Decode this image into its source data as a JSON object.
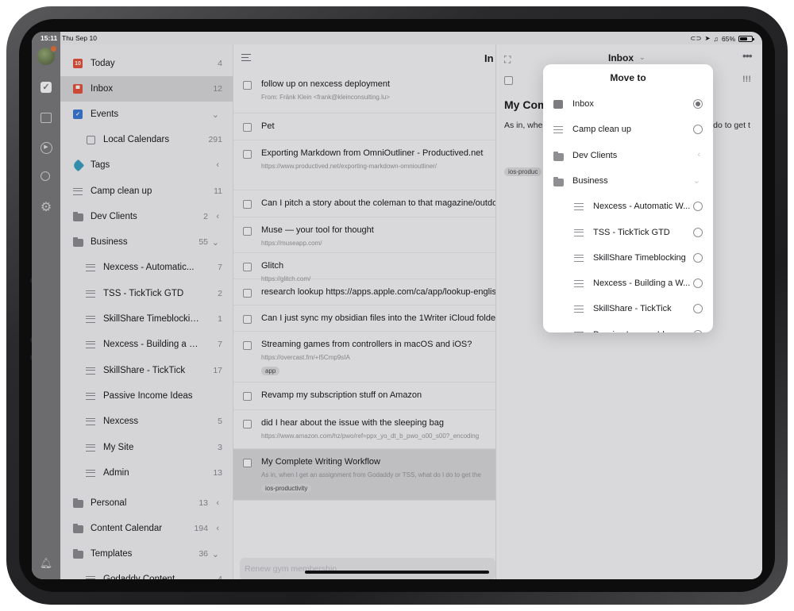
{
  "status_bar": {
    "time": "15:11",
    "date": "Thu Sep 10",
    "battery": "65%"
  },
  "sidebar": {
    "items": [
      {
        "label": "Today",
        "count": "4",
        "icon": "calendar-icon",
        "color": "#e8543f"
      },
      {
        "label": "Inbox",
        "count": "12",
        "icon": "inbox-icon",
        "color": "#e8543f"
      },
      {
        "label": "Events",
        "count": "",
        "icon": "events-icon",
        "color": "#3d7bd9"
      },
      {
        "label": "Local Calendars",
        "count": "291",
        "icon": "calendar-grid-icon"
      },
      {
        "label": "Tags",
        "count": "",
        "icon": "tag-icon",
        "color": "#3aa3c5"
      },
      {
        "label": "Camp clean up",
        "count": "11",
        "icon": "list-icon"
      },
      {
        "label": "Dev Clients",
        "count": "2",
        "icon": "folder-icon"
      },
      {
        "label": "Business",
        "count": "55",
        "icon": "folder-icon"
      },
      {
        "label": "Nexcess - Automatic...",
        "count": "7",
        "icon": "list-icon"
      },
      {
        "label": "TSS - TickTick GTD",
        "count": "2",
        "icon": "list-icon"
      },
      {
        "label": "SkillShare Timeblocking",
        "count": "1",
        "icon": "list-icon"
      },
      {
        "label": "Nexcess - Building a W...",
        "count": "7",
        "icon": "list-icon"
      },
      {
        "label": "SkillShare - TickTick",
        "count": "17",
        "icon": "shared-list-icon"
      },
      {
        "label": "Passive Income Ideas",
        "count": "",
        "icon": "list-icon"
      },
      {
        "label": "Nexcess",
        "count": "5",
        "icon": "list-icon"
      },
      {
        "label": "My Site",
        "count": "3",
        "icon": "list-icon"
      },
      {
        "label": "Admin",
        "count": "13",
        "icon": "list-icon"
      },
      {
        "label": "Personal",
        "count": "13",
        "icon": "folder-icon"
      },
      {
        "label": "Content Calendar",
        "count": "194",
        "icon": "folder-icon"
      },
      {
        "label": "Templates",
        "count": "36",
        "icon": "folder-icon"
      },
      {
        "label": "Godaddy Content",
        "count": "4",
        "icon": "list-icon"
      }
    ]
  },
  "list": {
    "header_title": "In",
    "tasks": [
      {
        "title": "follow up on nexcess deployment",
        "sub": "From: Fränk Klein <frank@kleinconsulting.lu>",
        "tag": ""
      },
      {
        "title": "Pet",
        "sub": "",
        "tag": ""
      },
      {
        "title": "Exporting Markdown from OmniOutliner - Productived.net",
        "sub": "https://www.productived.net/exporting-markdown-omnioutliner/",
        "tag": ""
      },
      {
        "title": "Can I pitch a story about the coleman to that magazine/outdoor",
        "sub": "",
        "tag": ""
      },
      {
        "title": "Muse — your tool for thought",
        "sub": "https://museapp.com/",
        "tag": ""
      },
      {
        "title": "Glitch",
        "sub": "https://glitch.com/",
        "tag": ""
      },
      {
        "title": "research lookup https://apps.apple.com/ca/app/lookup-english",
        "sub": "",
        "tag": ""
      },
      {
        "title": "Can I just sync my obsidian files into the 1Writer iCloud folder",
        "sub": "",
        "tag": ""
      },
      {
        "title": "Streaming games from controllers in macOS and iOS?",
        "sub": "https://overcast.fm/+I5Cmp9sIA",
        "tag": "app"
      },
      {
        "title": "Revamp my subscription stuff on Amazon",
        "sub": "",
        "tag": ""
      },
      {
        "title": "did I hear about the issue with the sleeping bag",
        "sub": "https://www.amazon.com/hz/pwo/ref=ppx_yo_dt_b_pwo_o00_s00?_encoding",
        "tag": ""
      },
      {
        "title": "My Complete Writing Workflow",
        "sub": "As in, when I get an assignment from Godaddy or TSS, what do I do to get the",
        "tag": "ios-productivity"
      }
    ],
    "quick_add_placeholder": "Renew gym membership"
  },
  "detail": {
    "list_name": "Inbox",
    "title": "My Com",
    "body": "As in, whe                                                          what do I do to get t",
    "tag": "ios-produc"
  },
  "popover": {
    "title": "Move to",
    "items": [
      {
        "label": "Inbox",
        "icon": "inbox-icon",
        "selected": true
      },
      {
        "label": "Camp clean up",
        "icon": "list-icon",
        "selected": false
      },
      {
        "label": "Dev Clients",
        "icon": "folder-icon",
        "selected": false
      },
      {
        "label": "Business",
        "icon": "folder-icon",
        "selected": false
      },
      {
        "label": "Nexcess - Automatic W...",
        "icon": "list-icon",
        "selected": false
      },
      {
        "label": "TSS - TickTick GTD",
        "icon": "list-icon",
        "selected": false
      },
      {
        "label": "SkillShare Timeblocking",
        "icon": "list-icon",
        "selected": false
      },
      {
        "label": "Nexcess - Building a W...",
        "icon": "list-icon",
        "selected": false
      },
      {
        "label": "SkillShare - TickTick",
        "icon": "shared-list-icon",
        "selected": false
      },
      {
        "label": "Passive Income Ideas",
        "icon": "list-icon",
        "selected": false
      }
    ]
  },
  "colors": {
    "accent": "#e8543f",
    "events": "#3d7bd9",
    "tags": "#3aa3c5"
  }
}
